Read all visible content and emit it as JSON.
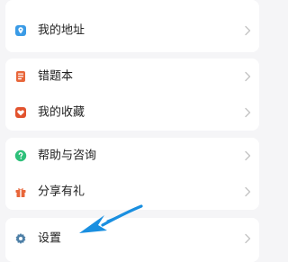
{
  "menu": {
    "group1": {
      "items": [
        {
          "label": "我的地址",
          "icon": "location-pin-icon",
          "icon_color": "#3a9be6"
        }
      ]
    },
    "group2": {
      "items": [
        {
          "label": "错题本",
          "icon": "notebook-icon",
          "icon_color": "#e8663a"
        },
        {
          "label": "我的收藏",
          "icon": "heart-icon",
          "icon_color": "#e2532e"
        }
      ]
    },
    "group3": {
      "items": [
        {
          "label": "帮助与咨询",
          "icon": "help-icon",
          "icon_color": "#2ec07a"
        },
        {
          "label": "分享有礼",
          "icon": "gift-icon",
          "icon_color": "#e8663a"
        }
      ]
    },
    "group4": {
      "items": [
        {
          "label": "设置",
          "icon": "gear-icon",
          "icon_color": "#4d7fa6"
        }
      ]
    }
  },
  "annotation": {
    "arrow_color": "#1a8fe0"
  }
}
